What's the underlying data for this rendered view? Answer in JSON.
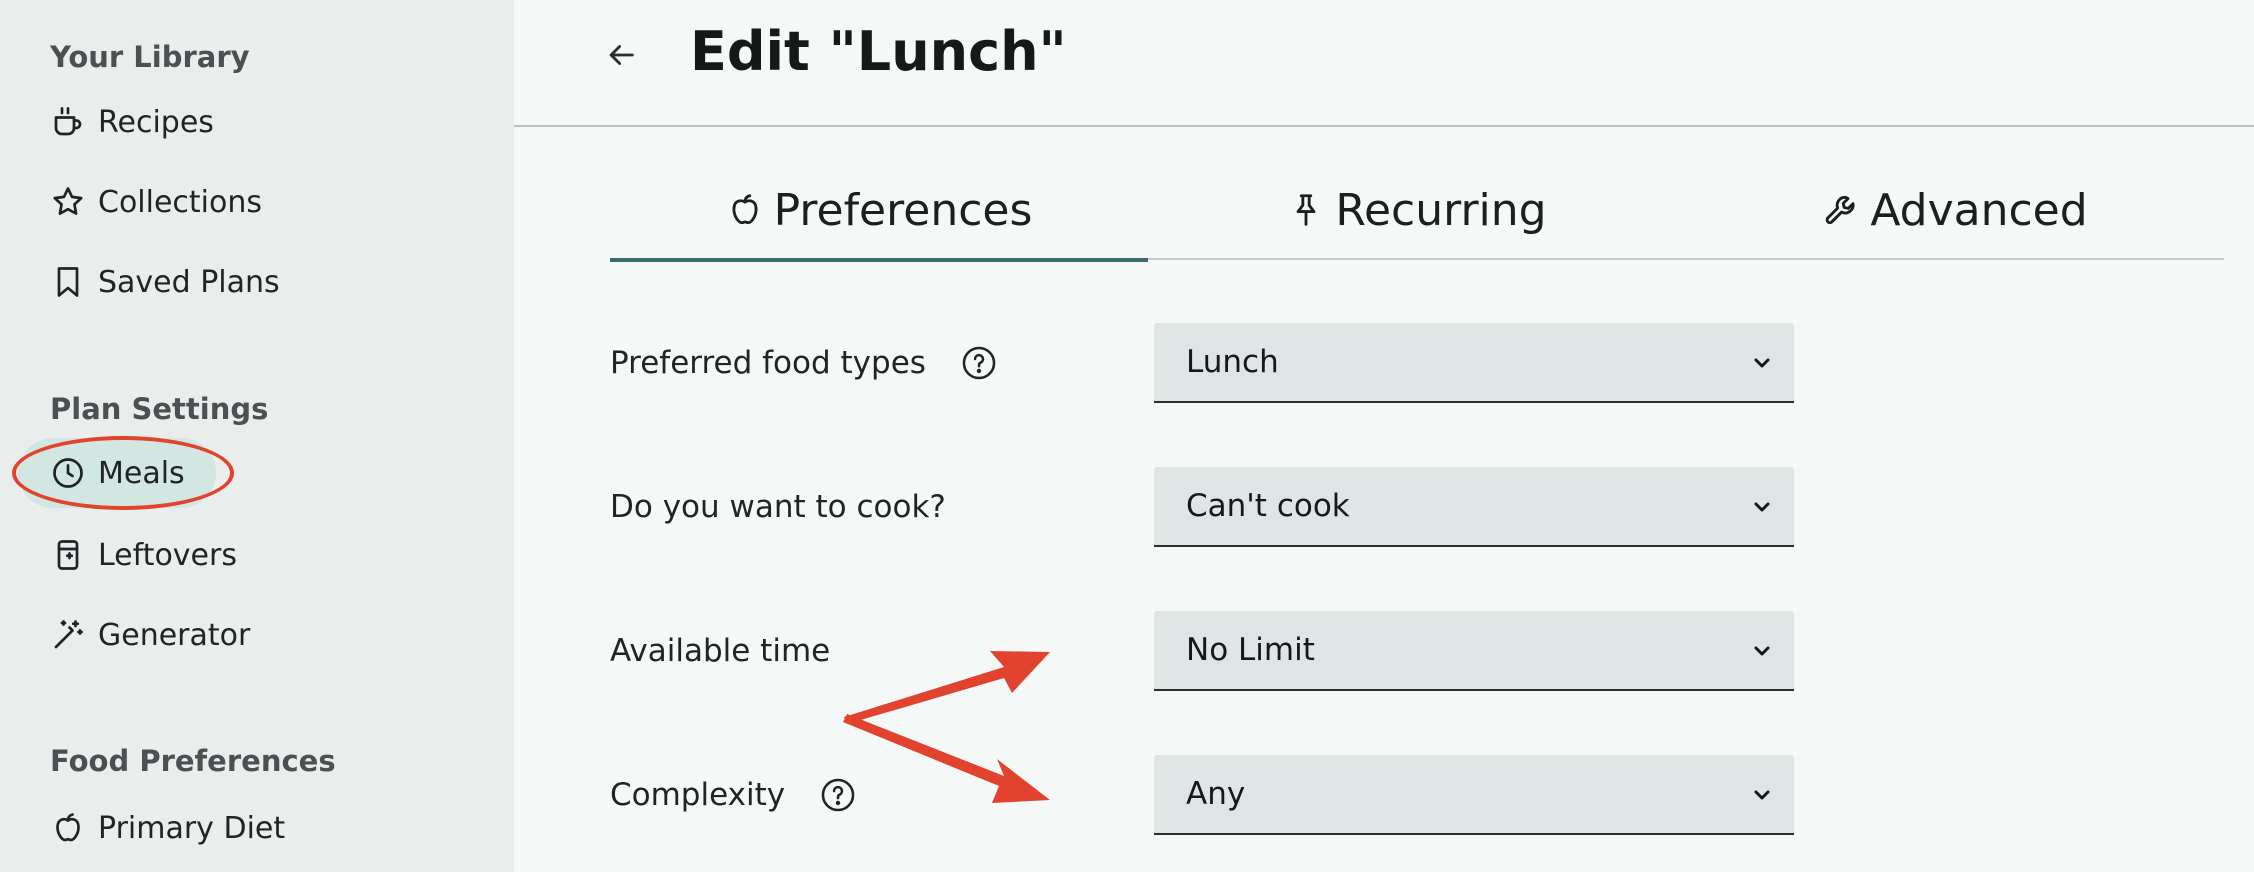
{
  "sidebar": {
    "library_heading": "Your Library",
    "library_items": [
      {
        "label": "Recipes",
        "icon": "mug-icon"
      },
      {
        "label": "Collections",
        "icon": "star-icon"
      },
      {
        "label": "Saved Plans",
        "icon": "bookmark-icon"
      }
    ],
    "plan_heading": "Plan Settings",
    "plan_items": [
      {
        "label": "Meals",
        "icon": "clock-icon",
        "active": true
      },
      {
        "label": "Leftovers",
        "icon": "container-icon"
      },
      {
        "label": "Generator",
        "icon": "magic-wand-icon"
      }
    ],
    "food_heading": "Food Preferences",
    "food_items": [
      {
        "label": "Primary Diet",
        "icon": "apple-icon"
      }
    ]
  },
  "header": {
    "title": "Edit \"Lunch\""
  },
  "tabs": [
    {
      "label": "Preferences",
      "icon": "apple-icon",
      "active": true
    },
    {
      "label": "Recurring",
      "icon": "pin-icon"
    },
    {
      "label": "Advanced",
      "icon": "wrench-icon"
    }
  ],
  "form": {
    "rows": [
      {
        "label": "Preferred food types",
        "value": "Lunch",
        "has_help": true
      },
      {
        "label": "Do you want to cook?",
        "value": "Can't cook",
        "has_help": false
      },
      {
        "label": "Available time",
        "value": "No Limit",
        "has_help": false
      },
      {
        "label": "Complexity",
        "value": "Any",
        "has_help": true
      }
    ]
  },
  "colors": {
    "sidebar_bg": "#e9eeed",
    "main_bg": "#f4f8f7",
    "active_nav_bg": "#d2e6e2",
    "tab_underline": "#3b6b6c",
    "annotation_red": "#e2432e"
  }
}
